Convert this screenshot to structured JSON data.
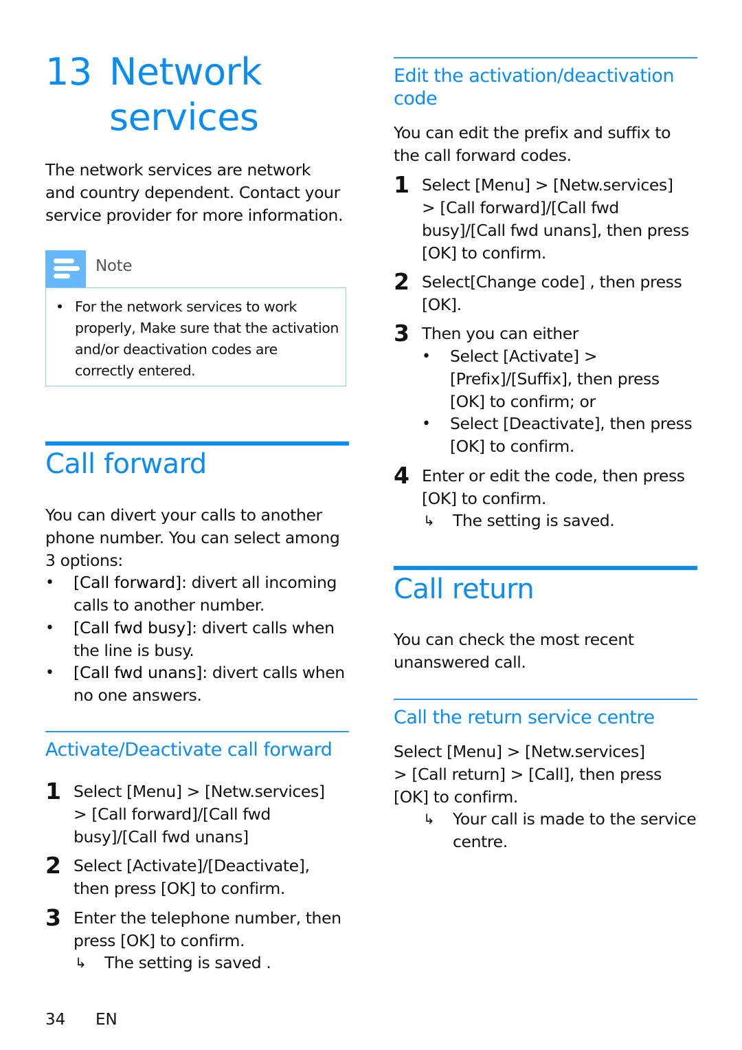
{
  "chapter": {
    "number": "13",
    "title_line1": "Network",
    "title_line2": "services"
  },
  "intro": {
    "lines": [
      "The network services are network",
      "and country dependent. Contact your",
      "service provider for more information."
    ]
  },
  "note": {
    "icon": "note-lines-icon",
    "title": "Note",
    "bullet": "•",
    "lines": [
      "For the network services to work",
      "properly, Make sure that the activation",
      "and/or deactivation codes are",
      "correctly entered."
    ]
  },
  "call_forward": {
    "heading": "Call forward",
    "intro_lines": [
      "You can divert your calls to another",
      "phone number. You can select among",
      "3 options:"
    ],
    "options": [
      {
        "term": "[Call forward]",
        "desc": ": divert all incoming",
        "cont": "calls to another number."
      },
      {
        "term": "[Call fwd busy]",
        "desc": ": divert calls when",
        "cont": "the line is busy."
      },
      {
        "term": "[Call fwd unans]",
        "desc": ": divert calls when",
        "cont": "no one answers."
      }
    ],
    "subsection": {
      "heading": "Activate/Deactivate call forward",
      "steps": [
        {
          "n": "1",
          "lines": [
            "Select [Menu] > [Netw.services]",
            "> [Call forward]/[Call fwd",
            "busy]/[Call fwd unans]"
          ]
        },
        {
          "n": "2",
          "lines": [
            "Select [Activate]/[Deactivate],",
            "then press [OK] to confirm."
          ]
        },
        {
          "n": "3",
          "lines": [
            "Enter the telephone number, then",
            "press [OK] to confirm."
          ]
        }
      ],
      "result": "The setting is saved ."
    }
  },
  "edit_code": {
    "heading_line1": "Edit the activation/deactivation",
    "heading_line2": "code",
    "intro_lines": [
      "You can edit the prefix and suffix to",
      "the call forward codes."
    ],
    "steps": [
      {
        "n": "1",
        "lines": [
          "Select [Menu] > [Netw.services]",
          "> [Call forward]/[Call fwd",
          "busy]/[Call fwd unans], then press",
          "[OK] to confirm."
        ]
      },
      {
        "n": "2",
        "lines": [
          "Select[Change code] , then press",
          "[OK]."
        ]
      },
      {
        "n": "3",
        "lines": [
          "Then you can either"
        ]
      },
      {
        "n": "4",
        "lines": [
          "Enter or edit the code, then press",
          "[OK] to confirm."
        ]
      }
    ],
    "step3_options": [
      {
        "lines": [
          "Select [Activate] >",
          "[Prefix]/[Suffix], then press",
          "[OK] to confirm; or"
        ]
      },
      {
        "lines": [
          "Select [Deactivate], then press",
          "[OK] to confirm."
        ]
      }
    ],
    "result": "The setting is saved."
  },
  "call_return": {
    "heading": "Call return",
    "intro_lines": [
      "You can check the most recent",
      "unanswered call."
    ],
    "subsection": {
      "heading": "Call the return service centre",
      "lines": [
        "Select [Menu] > [Netw.services]",
        "> [Call return] > [Call], then press",
        "[OK] to confirm."
      ],
      "result_lines": [
        "Your call is made to the service",
        "centre."
      ]
    }
  },
  "footer": {
    "page": "34",
    "lang": "EN"
  },
  "symbols": {
    "bullet": "•",
    "arrow": "↳"
  },
  "colors": {
    "accent": "#0a8cf0",
    "note_icon": "#66b8fb",
    "note_border": "#8ccafb"
  }
}
